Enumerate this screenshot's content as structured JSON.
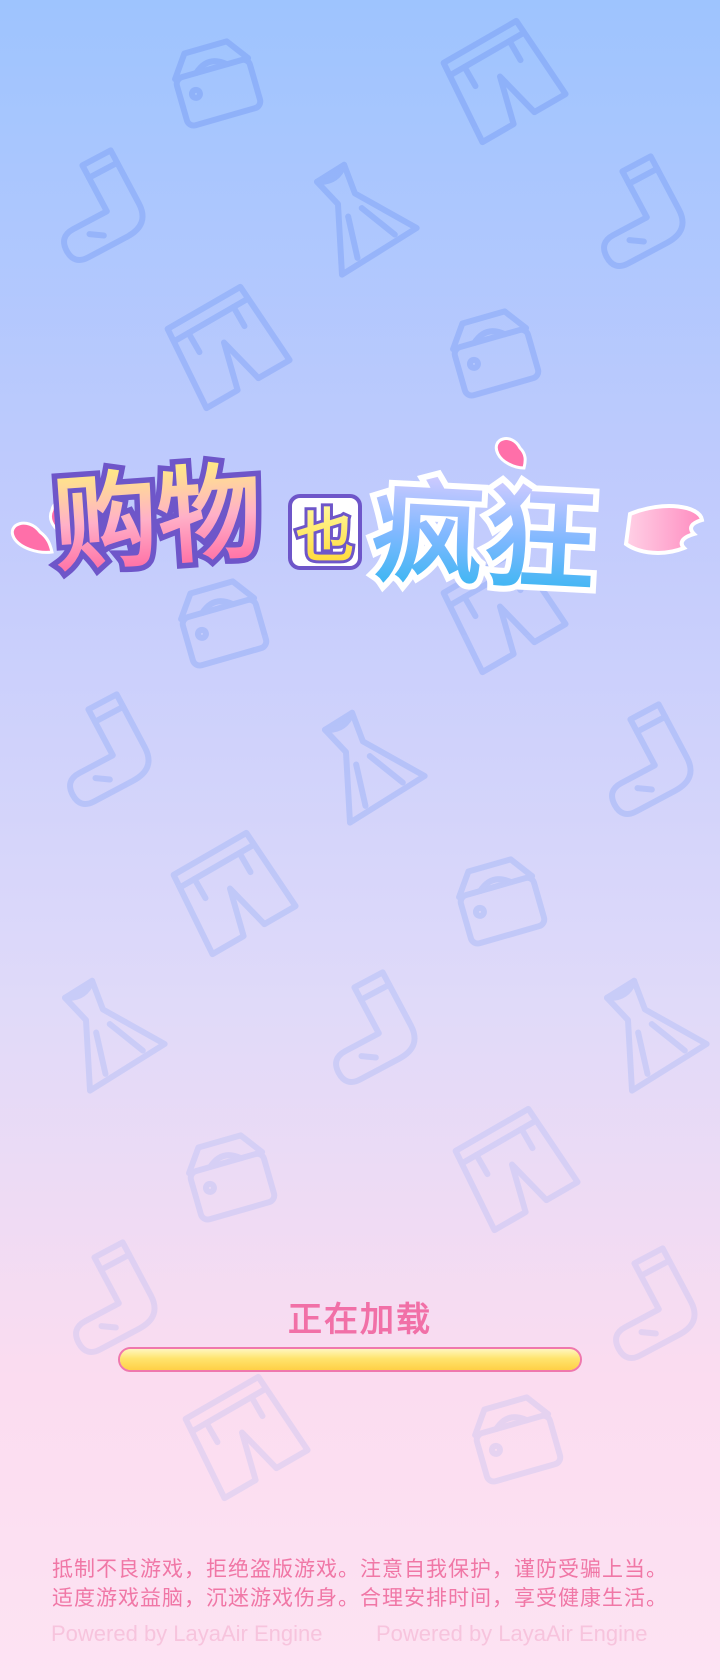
{
  "screen": {
    "background_top_color": "#9ec4fe",
    "background_bottom_color": "#fde3f3",
    "background_pattern_icons": [
      "handbag-icon",
      "jeans-icon",
      "sock-icon",
      "dress-icon"
    ]
  },
  "logo": {
    "title": "购物也疯狂",
    "part_1": "购物",
    "part_2": "也",
    "part_3": "疯狂",
    "decorations": [
      "heart-icon",
      "heart-icon",
      "wing-icon"
    ]
  },
  "loading": {
    "label": "正在加载",
    "progress": 1.0,
    "bar_color": "#ffd94e",
    "border_color": "#ef78ad"
  },
  "footer": {
    "notice_line_1": "抵制不良游戏，拒绝盗版游戏。注意自我保护，谨防受骗上当。",
    "notice_line_2": "适度游戏益脑，沉迷游戏伤身。合理安排时间，享受健康生活。",
    "powered_by_left": "Powered by LayaAir Engine",
    "powered_by_right": "Powered by LayaAir Engine",
    "text_color": "#f077a6"
  }
}
